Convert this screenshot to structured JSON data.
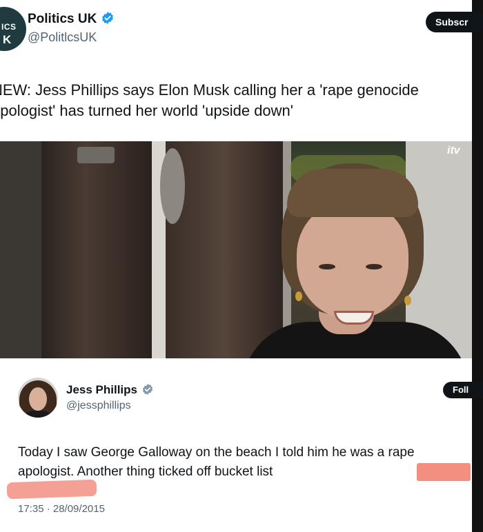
{
  "top_tweet": {
    "avatar_text_1": "ICS",
    "avatar_text_2": "K",
    "display_name": "Politics UK",
    "handle": "@PolitlcsUK",
    "subscribe_label": "Subscr",
    "text": "NEW: Jess Phillips says Elon Musk calling her a 'rape genocide apologist' has turned her world 'upside down'"
  },
  "video": {
    "watermark": "itv"
  },
  "quoted_tweet": {
    "display_name": "Jess Phillips",
    "handle": "@jessphillips",
    "follow_label": "Foll",
    "text": "Today I saw George Galloway on the beach I told him he was a rape apologist. Another thing ticked off bucket list",
    "timestamp": "17:35 · 28/09/2015"
  },
  "colors": {
    "verified_blue": "#1d9bf0",
    "verified_gray": "#829aab",
    "redaction": "#f08070"
  }
}
